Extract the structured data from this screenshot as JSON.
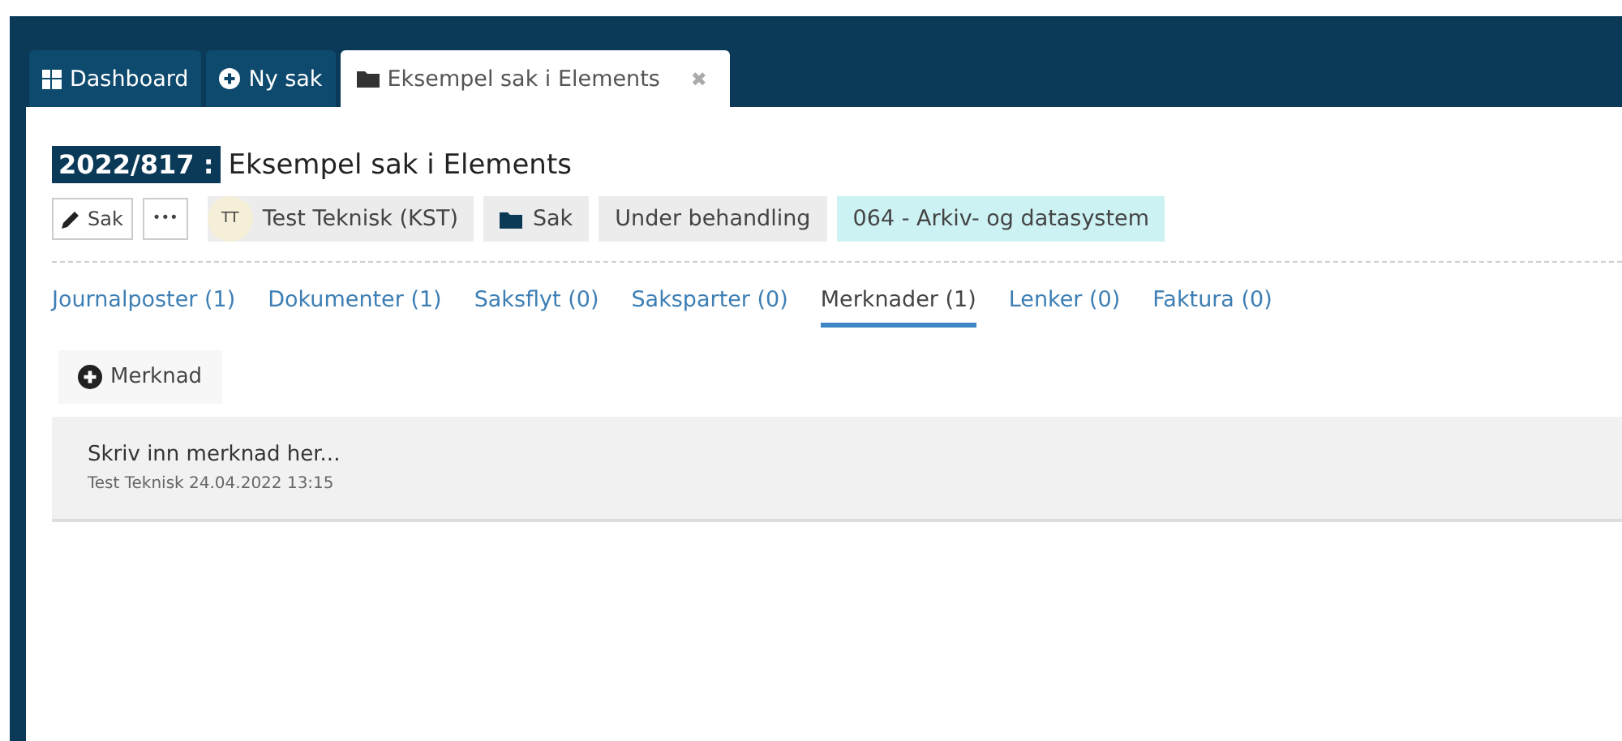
{
  "tabs": [
    {
      "label": "Dashboard",
      "kind": "grid",
      "selected": false
    },
    {
      "label": "Ny sak",
      "kind": "plus",
      "selected": false
    },
    {
      "label": "Eksempel sak i Elements",
      "kind": "folder",
      "selected": true,
      "close": "✖"
    }
  ],
  "case": {
    "number": "2022/817 :",
    "title": "Eksempel sak i Elements"
  },
  "toolbar": {
    "edit_button": "Sak",
    "more_button": "•••"
  },
  "chips": [
    {
      "kind": "person",
      "initials": "TT",
      "label": "Test Teknisk (KST)"
    },
    {
      "kind": "folder",
      "label": "Sak"
    },
    {
      "kind": "status",
      "label": "Under behandling"
    },
    {
      "kind": "class",
      "label": "064 - Arkiv- og datasystem"
    }
  ],
  "subtabs": [
    {
      "label": "Journalposter (1)",
      "selected": false
    },
    {
      "label": "Dokumenter (1)",
      "selected": false
    },
    {
      "label": "Saksflyt (0)",
      "selected": false
    },
    {
      "label": "Saksparter (0)",
      "selected": false
    },
    {
      "label": "Merknader (1)",
      "selected": true
    },
    {
      "label": "Lenker (0)",
      "selected": false
    },
    {
      "label": "Faktura (0)",
      "selected": false
    }
  ],
  "add_button": "Merknad",
  "notes": [
    {
      "text": "Skriv inn merknad her...",
      "meta": "Test Teknisk 24.04.2022 13:15"
    }
  ]
}
